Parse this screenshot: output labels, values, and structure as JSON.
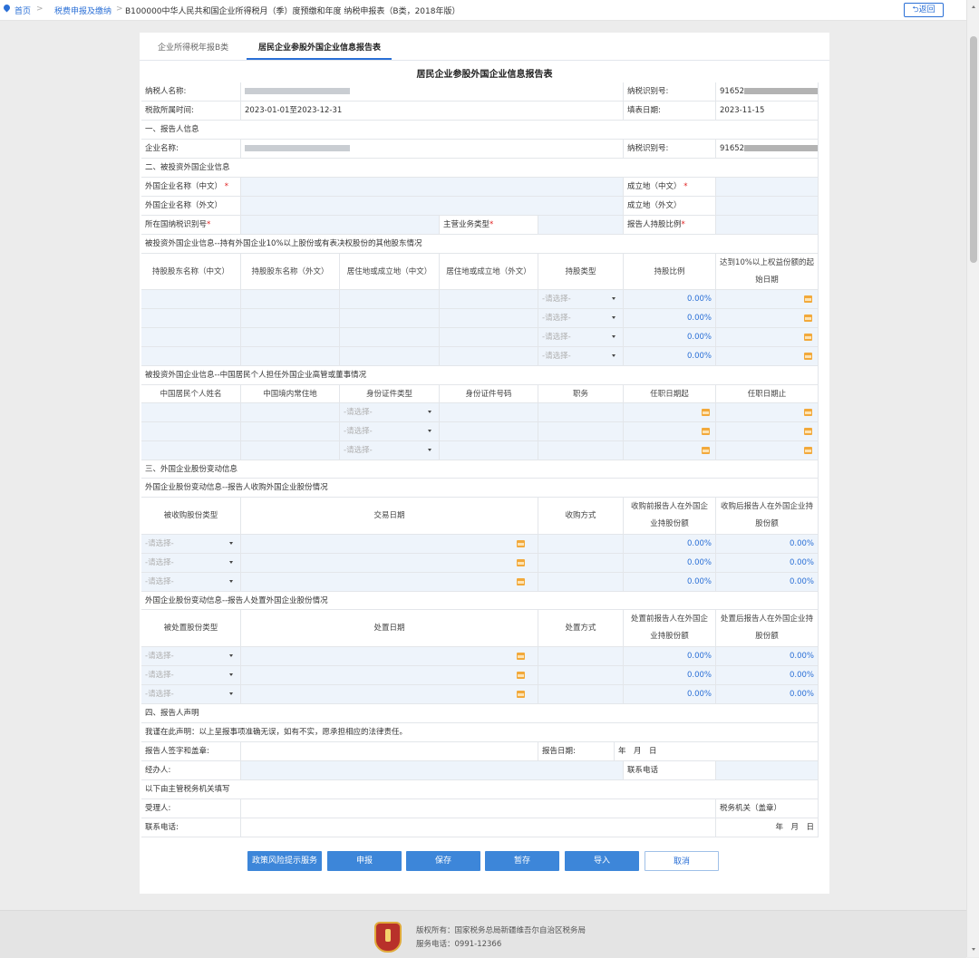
{
  "breadcrumb": {
    "home": "首页",
    "level2": "税费申报及缴纳",
    "current": "B100000中华人民共和国企业所得税月（季）度预缴和年度 纳税申报表（B类，2018年版）",
    "back": "返回"
  },
  "tabs": [
    "企业所得税年报B类",
    "居民企业参股外国企业信息报告表"
  ],
  "form_title": "居民企业参股外国企业信息报告表",
  "top": {
    "taxpayer_name_label": "纳税人名称:",
    "tax_id_label": "纳税识别号:",
    "tax_id_prefix": "91652",
    "tax_id_suffix": "0",
    "period_label": "税款所属时间:",
    "period_value": "2023-01-01至2023-12-31",
    "fill_date_label": "填表日期:",
    "fill_date_value": "2023-11-15"
  },
  "sec1": {
    "title": "一、报告人信息",
    "company_label": "企业名称:",
    "tax_id_label": "纳税识别号:",
    "tax_id_prefix": "91652",
    "tax_id_suffix": "30"
  },
  "sec2": {
    "title": "二、被投资外国企业信息",
    "name_cn": "外国企业名称（中文）",
    "name_en": "外国企业名称（外文）",
    "country_tax_id": "所在国纳税识别号",
    "main_business": "主营业务类型",
    "est_cn": "成立地（中文）",
    "est_en": "成立地（外文）",
    "holding_ratio": "报告人持股比例"
  },
  "shareholders": {
    "title": "被投资外国企业信息--持有外国企业10%以上股份或有表决权股份的其他股东情况",
    "headers": [
      "持股股东名称（中文）",
      "持股股东名称（外文）",
      "居住地或成立地（中文）",
      "居住地或成立地（外文）",
      "持股类型",
      "持股比例",
      "达到10%以上权益份额的起始日期"
    ],
    "rows": [
      {
        "select": "-请选择-",
        "pct": "0.00%"
      },
      {
        "select": "-请选择-",
        "pct": "0.00%"
      },
      {
        "select": "-请选择-",
        "pct": "0.00%"
      },
      {
        "select": "-请选择-",
        "pct": "0.00%"
      }
    ]
  },
  "executives": {
    "title": "被投资外国企业信息--中国居民个人担任外国企业高管或董事情况",
    "headers": [
      "中国居民个人姓名",
      "中国境内常住地",
      "身份证件类型",
      "身份证件号码",
      "职务",
      "任职日期起",
      "任职日期止"
    ],
    "rows": [
      {
        "select": "-请选择-"
      },
      {
        "select": "-请选择-"
      },
      {
        "select": "-请选择-"
      }
    ]
  },
  "sec3": {
    "title": "三、外国企业股份变动信息",
    "acq_title": "外国企业股份变动信息--报告人收购外国企业股份情况",
    "acq_headers": [
      "被收购股份类型",
      "交易日期",
      "收购方式",
      "收购前报告人在外国企业持股份额",
      "收购后报告人在外国企业持股份额"
    ],
    "acq_rows": [
      {
        "select": "-请选择-",
        "before": "0.00%",
        "after": "0.00%"
      },
      {
        "select": "-请选择-",
        "before": "0.00%",
        "after": "0.00%"
      },
      {
        "select": "-请选择-",
        "before": "0.00%",
        "after": "0.00%"
      }
    ],
    "disp_title": "外国企业股份变动信息--报告人处置外国企业股份情况",
    "disp_headers": [
      "被处置股份类型",
      "处置日期",
      "处置方式",
      "处置前报告人在外国企业持股份额",
      "处置后报告人在外国企业持股份额"
    ],
    "disp_rows": [
      {
        "select": "-请选择-",
        "before": "0.00%",
        "after": "0.00%"
      },
      {
        "select": "-请选择-",
        "before": "0.00%",
        "after": "0.00%"
      },
      {
        "select": "-请选择-",
        "before": "0.00%",
        "after": "0.00%"
      }
    ]
  },
  "sec4": {
    "title": "四、报告人声明",
    "statement": "我谨在此声明：以上呈报事项准确无误，如有不实，愿承担相应的法律责任。",
    "sign_label": "报告人签字和盖章:",
    "report_date_label": "报告日期:",
    "ymd": "年　月　日",
    "handler_label": "经办人:",
    "phone_label": "联系电话",
    "authority_note": "以下由主管税务机关填写",
    "receiver_label": "受理人:",
    "tax_office_label": "税务机关（盖章）",
    "contact_label": "联系电话:"
  },
  "buttons": [
    "政策风险提示服务",
    "申报",
    "保存",
    "暂存",
    "导入",
    "取消"
  ],
  "footer": {
    "copyright": "版权所有：国家税务总局新疆维吾尔自治区税务局",
    "phone": "服务电话：0991-12366"
  }
}
